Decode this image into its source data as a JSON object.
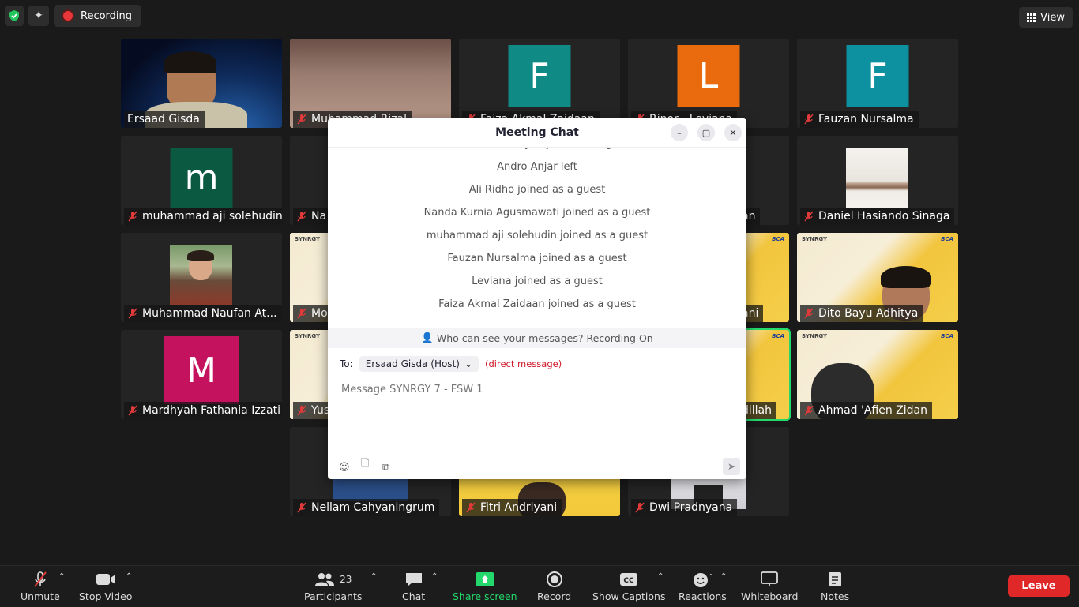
{
  "topbar": {
    "recording_label": "Recording",
    "view_label": "View"
  },
  "tiles": {
    "t1": "Ersaad Gisda",
    "t2": "Muhammad Rizal",
    "t3": "Faiza Akmal Zaidaan",
    "t4": "Rinor - Leviana",
    "t5": "Fauzan Nursalma",
    "t6": "muhammad aji solehudin",
    "t7": "Na",
    "t8": "an",
    "t9": "Daniel Hasiando Sinaga",
    "t10": "Muhammad Naufan At...",
    "t11": "Mo",
    "t12": "ani",
    "t13": "Dito Bayu Adhitya",
    "t14": "Mardhyah Fathania Izzati",
    "t15": "Yus",
    "t16": "dillah",
    "t17": "Ahmad 'Afien Zidan",
    "t18": "Nellam Cahyaningrum",
    "t19": "Fitri Andriyani",
    "t20": "Dwi Pradnyana"
  },
  "avatars": {
    "a3": {
      "letter": "F",
      "color": "#0f8a84"
    },
    "a4": {
      "letter": "L",
      "color": "#ea6b0d"
    },
    "a5": {
      "letter": "F",
      "color": "#0d91a0"
    },
    "a6": {
      "letter": "m",
      "color": "#0b5940"
    },
    "a14": {
      "letter": "M",
      "color": "#c5125e"
    }
  },
  "chat": {
    "title": "Meeting Chat",
    "messages": [
      "Resa Adliana Risyan joined as a guest",
      "Andro Anjar left",
      "Ali Ridho joined as a guest",
      "Nanda Kurnia Agusmawati joined as a guest",
      "muhammad aji solehudin joined as a guest",
      "Fauzan Nursalma joined as a guest",
      "Leviana joined as a guest",
      "Faiza Akmal Zaidaan joined as a guest"
    ],
    "who_can_see": "Who can see your messages? Recording On",
    "to_label": "To:",
    "recipient": "Ersaad Gisda (Host)",
    "direct_message": "(direct message)",
    "placeholder": "Message SYNRGY 7 - FSW 1"
  },
  "toolbar": {
    "unmute": "Unmute",
    "stop_video": "Stop Video",
    "participants": "Participants",
    "participants_count": "23",
    "chat": "Chat",
    "share_screen": "Share screen",
    "record": "Record",
    "show_captions": "Show Captions",
    "reactions": "Reactions",
    "whiteboard": "Whiteboard",
    "notes": "Notes",
    "leave": "Leave"
  },
  "colors": {
    "accent_green": "#23d96b",
    "leave_red": "#e02828",
    "recording_red": "#e8373a"
  }
}
